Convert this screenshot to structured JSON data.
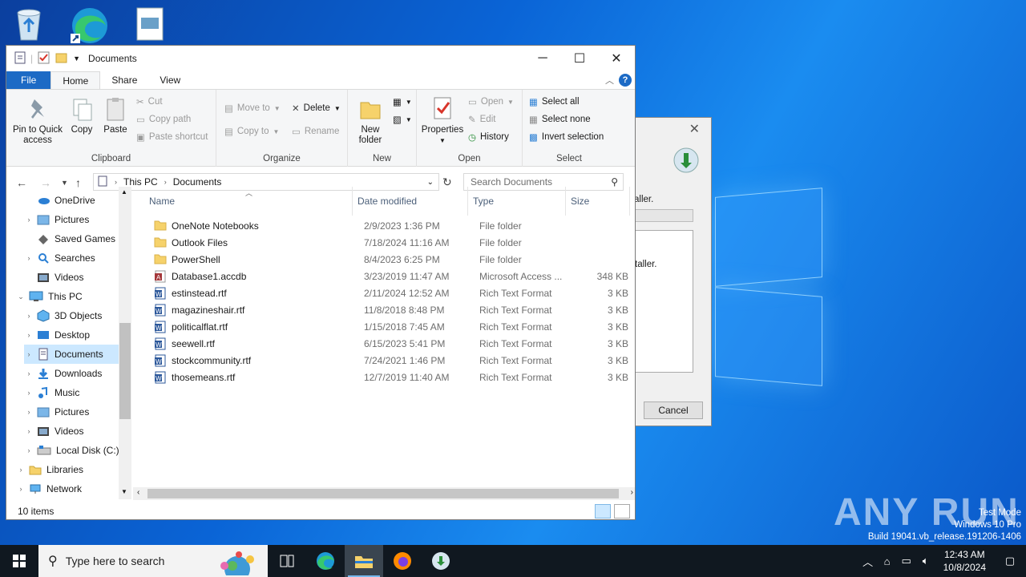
{
  "desktop": {
    "icons": [
      "recycle-bin-icon",
      "edge-icon",
      "document-icon"
    ]
  },
  "dialog": {
    "text1": "aller.",
    "text2": "taller.",
    "cancel_label": "Cancel"
  },
  "explorer": {
    "title": "Documents",
    "tabs": {
      "file": "File",
      "home": "Home",
      "share": "Share",
      "view": "View"
    },
    "ribbon": {
      "clipboard": {
        "label": "Clipboard",
        "pin": "Pin to Quick access",
        "copy": "Copy",
        "paste": "Paste",
        "cut": "Cut",
        "copy_path": "Copy path",
        "paste_shortcut": "Paste shortcut"
      },
      "organize": {
        "label": "Organize",
        "move_to": "Move to",
        "copy_to": "Copy to",
        "delete": "Delete",
        "rename": "Rename"
      },
      "new": {
        "label": "New",
        "new_folder_1": "New",
        "new_folder_2": "folder"
      },
      "open": {
        "label": "Open",
        "properties": "Properties",
        "open": "Open",
        "edit": "Edit",
        "history": "History"
      },
      "select": {
        "label": "Select",
        "select_all": "Select all",
        "select_none": "Select none",
        "invert": "Invert selection"
      }
    },
    "address": {
      "this_pc": "This PC",
      "documents": "Documents",
      "search_placeholder": "Search Documents"
    },
    "nav": [
      {
        "label": "OneDrive",
        "icon": "cloud-icon",
        "expand": false
      },
      {
        "label": "Pictures",
        "icon": "pictures-icon",
        "expand": true
      },
      {
        "label": "Saved Games",
        "icon": "saved-games-icon",
        "expand": false
      },
      {
        "label": "Searches",
        "icon": "searches-icon",
        "expand": true
      },
      {
        "label": "Videos",
        "icon": "videos-icon",
        "expand": false
      },
      {
        "label": "This PC",
        "icon": "computer-icon",
        "expand": "open"
      },
      {
        "label": "3D Objects",
        "icon": "3d-objects-icon",
        "expand": true
      },
      {
        "label": "Desktop",
        "icon": "desktop-icon",
        "expand": true
      },
      {
        "label": "Documents",
        "icon": "documents-icon",
        "expand": true,
        "selected": true
      },
      {
        "label": "Downloads",
        "icon": "downloads-icon",
        "expand": true
      },
      {
        "label": "Music",
        "icon": "music-icon",
        "expand": true
      },
      {
        "label": "Pictures",
        "icon": "pictures-icon",
        "expand": true
      },
      {
        "label": "Videos",
        "icon": "videos-icon",
        "expand": true
      },
      {
        "label": "Local Disk (C:)",
        "icon": "drive-icon",
        "expand": true
      },
      {
        "label": "Libraries",
        "icon": "libraries-icon",
        "expand": true
      },
      {
        "label": "Network",
        "icon": "network-icon",
        "expand": true
      }
    ],
    "columns": {
      "name": "Name",
      "date": "Date modified",
      "type": "Type",
      "size": "Size"
    },
    "files": [
      {
        "name": "OneNote Notebooks",
        "date": "2/9/2023 1:36 PM",
        "type": "File folder",
        "size": "",
        "icon": "folder-icon"
      },
      {
        "name": "Outlook Files",
        "date": "7/18/2024 11:16 AM",
        "type": "File folder",
        "size": "",
        "icon": "folder-icon"
      },
      {
        "name": "PowerShell",
        "date": "8/4/2023 6:25 PM",
        "type": "File folder",
        "size": "",
        "icon": "folder-icon"
      },
      {
        "name": "Database1.accdb",
        "date": "3/23/2019 11:47 AM",
        "type": "Microsoft Access ...",
        "size": "348 KB",
        "icon": "access-file-icon"
      },
      {
        "name": "estinstead.rtf",
        "date": "2/11/2024 12:52 AM",
        "type": "Rich Text Format",
        "size": "3 KB",
        "icon": "rtf-file-icon"
      },
      {
        "name": "magazineshair.rtf",
        "date": "11/8/2018 8:48 PM",
        "type": "Rich Text Format",
        "size": "3 KB",
        "icon": "rtf-file-icon"
      },
      {
        "name": "politicalflat.rtf",
        "date": "1/15/2018 7:45 AM",
        "type": "Rich Text Format",
        "size": "3 KB",
        "icon": "rtf-file-icon"
      },
      {
        "name": "seewell.rtf",
        "date": "6/15/2023 5:41 PM",
        "type": "Rich Text Format",
        "size": "3 KB",
        "icon": "rtf-file-icon"
      },
      {
        "name": "stockcommunity.rtf",
        "date": "7/24/2021 1:46 PM",
        "type": "Rich Text Format",
        "size": "3 KB",
        "icon": "rtf-file-icon"
      },
      {
        "name": "thosemeans.rtf",
        "date": "12/7/2019 11:40 AM",
        "type": "Rich Text Format",
        "size": "3 KB",
        "icon": "rtf-file-icon"
      }
    ],
    "status": "10 items"
  },
  "watermark": {
    "brand": "ANY RUN",
    "line1": "Test Mode",
    "line2": "Windows 10 Pro",
    "line3": "Build 19041.vb_release.191206-1406"
  },
  "taskbar": {
    "search_placeholder": "Type here to search",
    "time": "12:43 AM",
    "date": "10/8/2024",
    "apps": [
      "task-view-icon",
      "edge-icon",
      "file-explorer-icon",
      "firefox-icon",
      "installer-icon"
    ]
  },
  "colors": {
    "accent": "#1c6ac5",
    "selection": "#cce8ff",
    "folder": "#f6d26b",
    "taskbar": "#101820"
  }
}
